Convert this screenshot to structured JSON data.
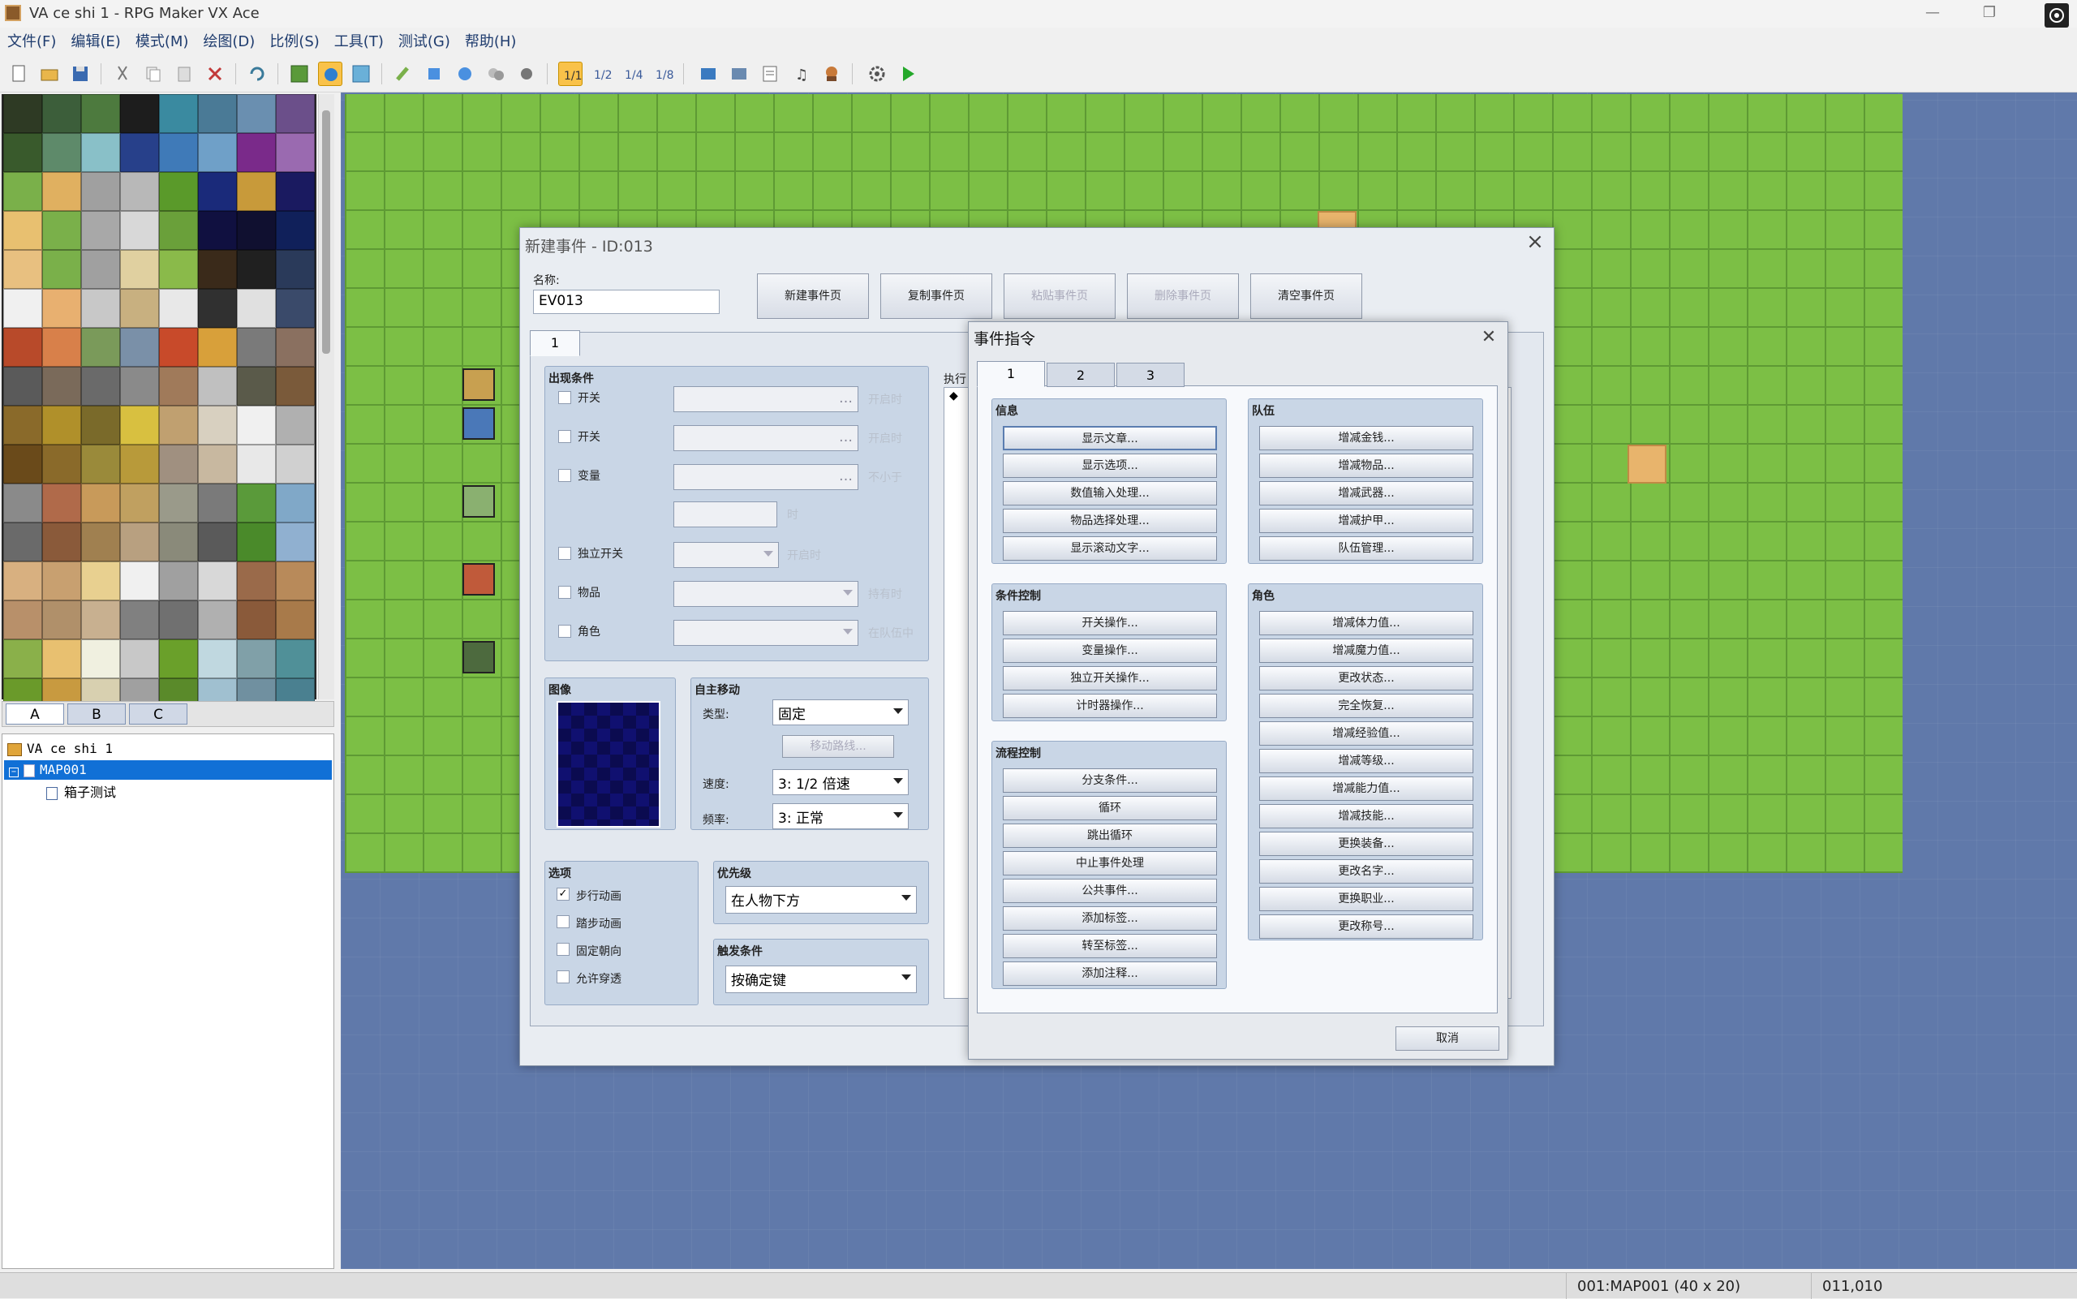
{
  "window": {
    "title": "VA ce shi 1 - RPG Maker VX Ace",
    "minimize": "—",
    "restore": "❐"
  },
  "menu": [
    "文件(F)",
    "编辑(E)",
    "模式(M)",
    "绘图(D)",
    "比例(S)",
    "工具(T)",
    "测试(G)",
    "帮助(H)"
  ],
  "tileset_tabs": {
    "a": "A",
    "b": "B",
    "c": "C"
  },
  "map_tree": {
    "root": "VA ce shi 1",
    "map": "MAP001",
    "child": "箱子测试"
  },
  "status": {
    "map": "001:MAP001 (40 x 20)",
    "coords": "011,010"
  },
  "event_dialog": {
    "title": "新建事件 - ID:013",
    "name_label": "名称:",
    "name_value": "EV013",
    "buttons": {
      "new": "新建事件页",
      "copy": "复制事件页",
      "paste": "粘贴事件页",
      "delete": "删除事件页",
      "clear": "清空事件页"
    },
    "page_tab": "1",
    "conditions": {
      "header": "出现条件",
      "switch1": "开关",
      "switch1_suffix": "开启时",
      "switch2": "开关",
      "switch2_suffix": "开启时",
      "variable": "变量",
      "variable_suffix": "不小于",
      "var_suffix2": "时",
      "self_switch": "独立开关",
      "self_switch_suffix": "开启时",
      "item": "物品",
      "item_suffix": "持有时",
      "actor": "角色",
      "actor_suffix": "在队伍中"
    },
    "image": {
      "header": "图像"
    },
    "autonomous": {
      "header": "自主移动",
      "type_label": "类型:",
      "type_value": "固定",
      "route_button": "移动路线...",
      "speed_label": "速度:",
      "speed_value": "3: 1/2 倍速",
      "freq_label": "频率:",
      "freq_value": "3: 正常"
    },
    "options": {
      "header": "选项",
      "walk": "步行动画",
      "stepping": "踏步动画",
      "direction_fix": "固定朝向",
      "through": "允许穿透",
      "walk_checked": "✓"
    },
    "priority": {
      "header": "优先级",
      "value": "在人物下方"
    },
    "trigger": {
      "header": "触发条件",
      "value": "按确定键"
    },
    "contents_label": "执行",
    "first_line": "◆"
  },
  "command_dialog": {
    "title": "事件指令",
    "close": "✕",
    "tabs": [
      "1",
      "2",
      "3"
    ],
    "groups": {
      "message": {
        "header": "信息",
        "items": [
          "显示文章...",
          "显示选项...",
          "数值输入处理...",
          "物品选择处理...",
          "显示滚动文字..."
        ]
      },
      "game_progress": {
        "header": "条件控制",
        "items": [
          "开关操作...",
          "变量操作...",
          "独立开关操作...",
          "计时器操作..."
        ]
      },
      "flow_control": {
        "header": "流程控制",
        "items": [
          "分支条件...",
          "循环",
          "跳出循环",
          "中止事件处理",
          "公共事件...",
          "添加标签...",
          "转至标签...",
          "添加注释..."
        ]
      },
      "party": {
        "header": "队伍",
        "items": [
          "增减金钱...",
          "增减物品...",
          "增减武器...",
          "增减护甲...",
          "队伍管理..."
        ]
      },
      "actor": {
        "header": "角色",
        "items": [
          "增减体力值...",
          "增减魔力值...",
          "更改状态...",
          "完全恢复...",
          "增减经验值...",
          "增减等级...",
          "增减能力值...",
          "增减技能...",
          "更换装备...",
          "更改名字...",
          "更换职业...",
          "更改称号..."
        ]
      }
    },
    "cancel": "取消"
  },
  "colors": {
    "grass": "#7cbf45",
    "water": "#6079aa",
    "selection": "#1170d6",
    "panel": "#c9d6e6"
  }
}
